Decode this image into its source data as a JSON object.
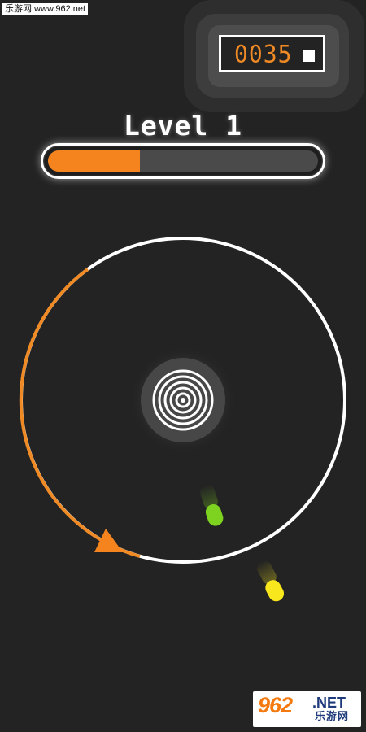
{
  "watermark_top": {
    "text": "乐游网 www.962.net"
  },
  "score": {
    "value": "0035",
    "pause_icon": "square-icon"
  },
  "level": {
    "title": "Level 1",
    "progress": 0.34
  },
  "logo": {
    "number": "962",
    "net": ".NET",
    "cn": "乐游网"
  },
  "colors": {
    "background": "#232323",
    "accent_orange": "#f08a24",
    "ball_green": "#7ed321",
    "ball_yellow": "#f8e71c",
    "ring": "#ffffff"
  }
}
